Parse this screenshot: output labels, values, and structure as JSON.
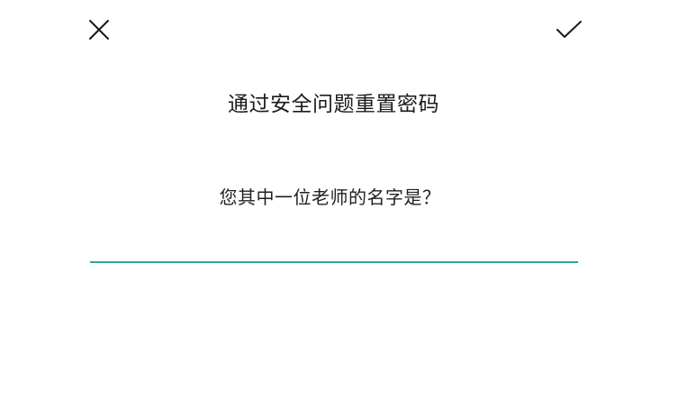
{
  "toolbar": {
    "close_icon": "close-icon",
    "confirm_icon": "check-icon"
  },
  "page": {
    "title": "通过安全问题重置密码",
    "question": "您其中一位老师的名字是？"
  },
  "answer": {
    "value": "",
    "placeholder": ""
  },
  "colors": {
    "accent": "#2ea89a",
    "text": "#1a1a1a",
    "background": "#ffffff"
  }
}
